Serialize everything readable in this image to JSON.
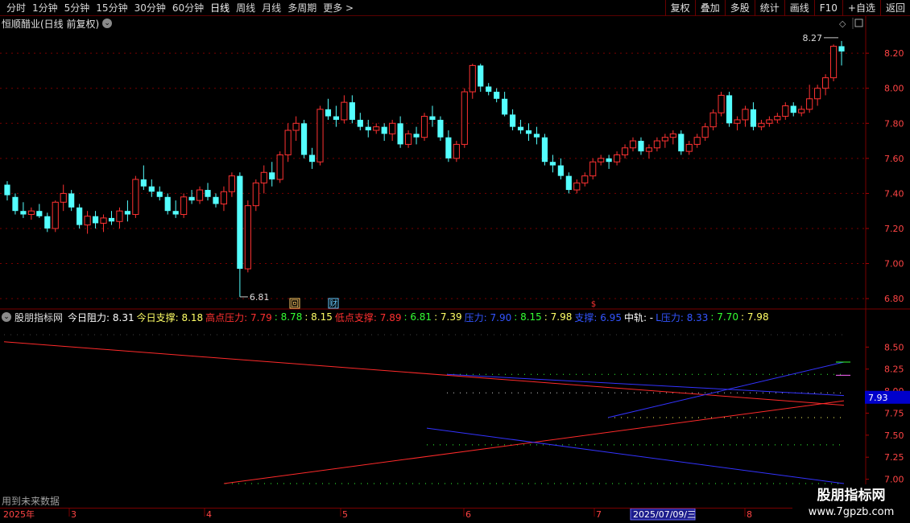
{
  "toolbar": {
    "periods": [
      "分时",
      "1分钟",
      "5分钟",
      "15分钟",
      "30分钟",
      "60分钟",
      "日线",
      "周线",
      "月线",
      "多周期",
      "更多 >"
    ],
    "active_period": "日线",
    "tools": [
      "复权",
      "叠加",
      "多股",
      "统计",
      "画线",
      "F10",
      "+自选",
      "返回"
    ]
  },
  "chart": {
    "title": "恒顺醋业(日线 前复权)",
    "price_axis": [
      "8.20",
      "8.00",
      "7.80",
      "7.60",
      "7.40",
      "7.20",
      "7.00",
      "6.80"
    ],
    "high_label": "8.27",
    "low_label": "6.81",
    "markers": [
      {
        "text": "回",
        "color": "#ffcc66"
      },
      {
        "text": "财",
        "color": "#66ccff"
      },
      {
        "text": "$",
        "color": "#ff3333"
      }
    ]
  },
  "indicator": {
    "name": "股朋指标网",
    "items": [
      {
        "text": "今日阻力: 8.31",
        "color": "#ffffff"
      },
      {
        "text": "今日支撑: 8.18",
        "color": "#ffff66"
      },
      {
        "text": "高点压力: 7.79",
        "color": "#ff3030"
      },
      {
        "text": ": 8.78",
        "color": "#33ff33"
      },
      {
        "text": ": 8.15",
        "color": "#ffff66"
      },
      {
        "text": "低点支撑: 7.89",
        "color": "#ff3030"
      },
      {
        "text": ": 6.81",
        "color": "#33ff33"
      },
      {
        "text": ": 7.39",
        "color": "#ffff66"
      },
      {
        "text": "压力: 7.90",
        "color": "#3355ff"
      },
      {
        "text": ": 8.15",
        "color": "#33ff33"
      },
      {
        "text": ": 7.98",
        "color": "#ffff66"
      },
      {
        "text": "支撑: 6.95",
        "color": "#3355ff"
      },
      {
        "text": "中轨: -",
        "color": "#ffffff"
      },
      {
        "text": "L压力: 8.33",
        "color": "#3355ff"
      },
      {
        "text": ": 7.70",
        "color": "#33ff33"
      },
      {
        "text": ": 7.98",
        "color": "#ffff66"
      }
    ],
    "axis": [
      "8.50",
      "8.25",
      "8.00",
      "7.75",
      "7.50",
      "7.25",
      "7.00"
    ],
    "current_value": "7.93",
    "future_note": "用到未来数据"
  },
  "timeline": {
    "labels": [
      "2025年",
      "3",
      "4",
      "5",
      "6",
      "7",
      "8"
    ],
    "cursor_date": "2025/07/09/三"
  },
  "watermark": {
    "name": "股朋指标网",
    "url": "www.7gpzb.com"
  },
  "colors": {
    "up": "#ff3232",
    "down": "#54ffff",
    "grid": "#7a0000",
    "blue": "#3333ff"
  },
  "chart_data": {
    "type": "candlestick",
    "dates_note": "daily bars from early 2025 to late July 2025",
    "ylim": [
      6.75,
      8.32
    ],
    "candles": [
      [
        7.45,
        7.47,
        7.36,
        7.39
      ],
      [
        7.38,
        7.4,
        7.28,
        7.3
      ],
      [
        7.3,
        7.35,
        7.26,
        7.28
      ],
      [
        7.28,
        7.32,
        7.25,
        7.3
      ],
      [
        7.3,
        7.34,
        7.26,
        7.27
      ],
      [
        7.27,
        7.29,
        7.18,
        7.2
      ],
      [
        7.2,
        7.36,
        7.18,
        7.35
      ],
      [
        7.35,
        7.45,
        7.3,
        7.4
      ],
      [
        7.4,
        7.42,
        7.3,
        7.32
      ],
      [
        7.32,
        7.34,
        7.2,
        7.22
      ],
      [
        7.22,
        7.3,
        7.17,
        7.27
      ],
      [
        7.27,
        7.3,
        7.2,
        7.23
      ],
      [
        7.23,
        7.28,
        7.18,
        7.26
      ],
      [
        7.26,
        7.3,
        7.22,
        7.24
      ],
      [
        7.24,
        7.32,
        7.2,
        7.3
      ],
      [
        7.3,
        7.36,
        7.24,
        7.28
      ],
      [
        7.28,
        7.5,
        7.26,
        7.48
      ],
      [
        7.48,
        7.56,
        7.42,
        7.44
      ],
      [
        7.44,
        7.48,
        7.38,
        7.41
      ],
      [
        7.41,
        7.44,
        7.36,
        7.38
      ],
      [
        7.38,
        7.4,
        7.28,
        7.3
      ],
      [
        7.3,
        7.36,
        7.26,
        7.28
      ],
      [
        7.28,
        7.4,
        7.26,
        7.38
      ],
      [
        7.38,
        7.42,
        7.34,
        7.36
      ],
      [
        7.36,
        7.44,
        7.34,
        7.42
      ],
      [
        7.42,
        7.46,
        7.36,
        7.38
      ],
      [
        7.38,
        7.4,
        7.32,
        7.34
      ],
      [
        7.34,
        7.44,
        7.3,
        7.41
      ],
      [
        7.41,
        7.52,
        7.38,
        7.5
      ],
      [
        7.5,
        7.52,
        6.81,
        6.97
      ],
      [
        6.97,
        7.36,
        6.95,
        7.33
      ],
      [
        7.33,
        7.48,
        7.3,
        7.46
      ],
      [
        7.46,
        7.56,
        7.4,
        7.52
      ],
      [
        7.52,
        7.58,
        7.44,
        7.48
      ],
      [
        7.48,
        7.64,
        7.46,
        7.62
      ],
      [
        7.62,
        7.8,
        7.58,
        7.76
      ],
      [
        7.76,
        7.84,
        7.7,
        7.8
      ],
      [
        7.8,
        7.82,
        7.6,
        7.62
      ],
      [
        7.62,
        7.66,
        7.54,
        7.58
      ],
      [
        7.58,
        7.9,
        7.56,
        7.88
      ],
      [
        7.88,
        7.94,
        7.82,
        7.84
      ],
      [
        7.84,
        7.9,
        7.78,
        7.82
      ],
      [
        7.82,
        7.96,
        7.8,
        7.92
      ],
      [
        7.92,
        7.96,
        7.8,
        7.82
      ],
      [
        7.82,
        7.86,
        7.76,
        7.78
      ],
      [
        7.78,
        7.82,
        7.72,
        7.76
      ],
      [
        7.76,
        7.8,
        7.74,
        7.78
      ],
      [
        7.78,
        7.8,
        7.7,
        7.74
      ],
      [
        7.74,
        7.82,
        7.7,
        7.8
      ],
      [
        7.8,
        7.84,
        7.66,
        7.68
      ],
      [
        7.68,
        7.76,
        7.66,
        7.74
      ],
      [
        7.74,
        7.78,
        7.68,
        7.72
      ],
      [
        7.72,
        7.86,
        7.7,
        7.84
      ],
      [
        7.84,
        7.9,
        7.78,
        7.82
      ],
      [
        7.82,
        7.84,
        7.7,
        7.72
      ],
      [
        7.72,
        7.76,
        7.58,
        7.6
      ],
      [
        7.6,
        7.7,
        7.58,
        7.68
      ],
      [
        7.68,
        8.0,
        7.66,
        7.98
      ],
      [
        7.98,
        8.14,
        7.94,
        8.13
      ],
      [
        8.13,
        8.14,
        7.98,
        8.01
      ],
      [
        8.01,
        8.03,
        7.96,
        7.98
      ],
      [
        7.98,
        8.0,
        7.92,
        7.94
      ],
      [
        7.94,
        7.98,
        7.84,
        7.85
      ],
      [
        7.85,
        7.88,
        7.76,
        7.78
      ],
      [
        7.78,
        7.82,
        7.74,
        7.76
      ],
      [
        7.76,
        7.8,
        7.7,
        7.74
      ],
      [
        7.74,
        7.78,
        7.68,
        7.72
      ],
      [
        7.72,
        7.74,
        7.56,
        7.58
      ],
      [
        7.58,
        7.62,
        7.52,
        7.56
      ],
      [
        7.56,
        7.6,
        7.48,
        7.5
      ],
      [
        7.5,
        7.52,
        7.4,
        7.42
      ],
      [
        7.42,
        7.48,
        7.4,
        7.46
      ],
      [
        7.46,
        7.52,
        7.44,
        7.5
      ],
      [
        7.5,
        7.6,
        7.48,
        7.58
      ],
      [
        7.58,
        7.62,
        7.56,
        7.6
      ],
      [
        7.6,
        7.62,
        7.54,
        7.58
      ],
      [
        7.58,
        7.64,
        7.56,
        7.62
      ],
      [
        7.62,
        7.68,
        7.6,
        7.66
      ],
      [
        7.66,
        7.72,
        7.64,
        7.7
      ],
      [
        7.7,
        7.72,
        7.62,
        7.64
      ],
      [
        7.64,
        7.68,
        7.6,
        7.66
      ],
      [
        7.66,
        7.72,
        7.64,
        7.7
      ],
      [
        7.7,
        7.74,
        7.66,
        7.72
      ],
      [
        7.72,
        7.76,
        7.68,
        7.74
      ],
      [
        7.74,
        7.76,
        7.62,
        7.64
      ],
      [
        7.64,
        7.7,
        7.62,
        7.68
      ],
      [
        7.68,
        7.74,
        7.66,
        7.72
      ],
      [
        7.72,
        7.8,
        7.7,
        7.78
      ],
      [
        7.78,
        7.88,
        7.76,
        7.86
      ],
      [
        7.86,
        7.98,
        7.84,
        7.96
      ],
      [
        7.96,
        7.98,
        7.78,
        7.8
      ],
      [
        7.8,
        7.84,
        7.76,
        7.82
      ],
      [
        7.82,
        7.9,
        7.78,
        7.88
      ],
      [
        7.88,
        7.92,
        7.76,
        7.78
      ],
      [
        7.78,
        7.82,
        7.76,
        7.8
      ],
      [
        7.8,
        7.84,
        7.78,
        7.82
      ],
      [
        7.82,
        7.86,
        7.8,
        7.84
      ],
      [
        7.84,
        7.92,
        7.82,
        7.9
      ],
      [
        7.9,
        7.92,
        7.84,
        7.86
      ],
      [
        7.86,
        7.9,
        7.84,
        7.88
      ],
      [
        7.88,
        8.02,
        7.86,
        7.94
      ],
      [
        7.94,
        8.02,
        7.9,
        8.0
      ],
      [
        8.0,
        8.08,
        7.96,
        8.06
      ],
      [
        8.06,
        8.25,
        8.04,
        8.24
      ],
      [
        8.24,
        8.27,
        8.13,
        8.21
      ]
    ]
  }
}
